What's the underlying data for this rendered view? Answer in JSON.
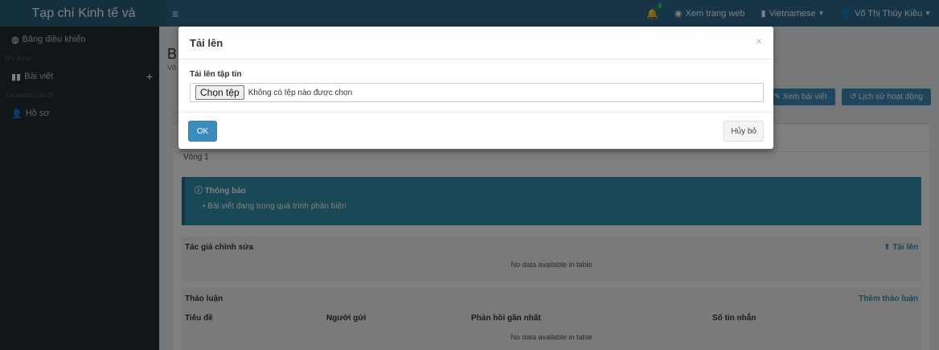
{
  "header": {
    "brand": "Tạp chí Kinh tế và",
    "menu_icon": "hamburger-icon",
    "bell_badge": "1",
    "view_site": "Xem trang web",
    "language": "Vietnamese",
    "user": "Võ Thị Thúy Kiều"
  },
  "sidebar": {
    "dashboard": "Bảng điều khiển",
    "content_header": "Nội dung",
    "articles": "Bài viết",
    "account_header": "Tài khoản của tôi",
    "profile": "Hồ sơ"
  },
  "content": {
    "title_initial": "B",
    "subtitle_initial": "Võ",
    "view_article": "Xem bài viết",
    "activity_log": "Lịch sử hoạt động",
    "round_tab": "Vòng 1",
    "notice_title": "Thông báo",
    "notice_item": "Bài viết đang trong quá trình phản biện",
    "author_edits": "Tác giả chỉnh sửa",
    "upload_link": "Tải lên",
    "no_data": "No data available in table",
    "discussion": "Thảo luận",
    "add_discussion": "Thêm thảo luận",
    "columns": [
      "Tiêu đề",
      "Người gửi",
      "Phản hồi gần nhất",
      "Số tin nhắn"
    ]
  },
  "modal": {
    "title": "Tải lên",
    "close": "×",
    "field_label": "Tải lên tập tin",
    "choose_file": "Chọn tệp",
    "no_file": "Không có tệp nào được chọn",
    "ok": "OK",
    "cancel": "Hủy bỏ"
  }
}
